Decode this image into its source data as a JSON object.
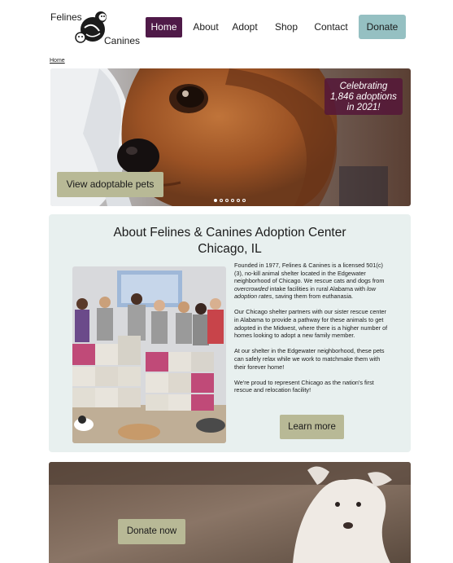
{
  "header": {
    "logo_top": "Felines",
    "logo_bottom": "Canines",
    "nav": [
      {
        "label": "Home",
        "active": true
      },
      {
        "label": "About"
      },
      {
        "label": "Adopt"
      },
      {
        "label": "Shop"
      },
      {
        "label": "Contact"
      }
    ],
    "donate_label": "Donate"
  },
  "breadcrumb": "Home",
  "hero": {
    "badge_line1": "Celebrating",
    "badge_line2": "1,846 adoptions",
    "badge_line3": "in 2021!",
    "button_label": "View adoptable pets",
    "slide_count": 6,
    "active_slide": 1
  },
  "about": {
    "title_line1": "About Felines & Canines Adoption Center",
    "title_line2": "Chicago, IL",
    "p1_a": "Founded in 1977, Felines & Canines is a licensed 501(c)(3), no-kill animal shelter located in the Edgewater neighborhood of Chicago. We rescue cats and dogs from ",
    "p1_em1": "overcrowded",
    "p1_b": " intake facilities in rural Alabama with ",
    "p1_em2": "low adoption rates",
    "p1_c": ", saving them from euthanasia.",
    "p2": "Our Chicago shelter partners with our sister rescue center in Alabama to provide a pathway for these animals to get adopted in the Midwest, where there is a higher number of homes looking to adopt a new family member.",
    "p3": "At our shelter in the Edgewater neighborhood, these pets can safely relax while we work to matchmake them with their forever home!",
    "p4": "We're proud to represent Chicago as the nation's first rescue and relocation facility!",
    "button_label": "Learn more"
  },
  "donate_section": {
    "button_label": "Donate now"
  },
  "colors": {
    "nav_active": "#4f1a48",
    "donate": "#95c0c2",
    "button": "#b8b996",
    "about_bg": "#e8f0ef",
    "badge": "#551638"
  }
}
